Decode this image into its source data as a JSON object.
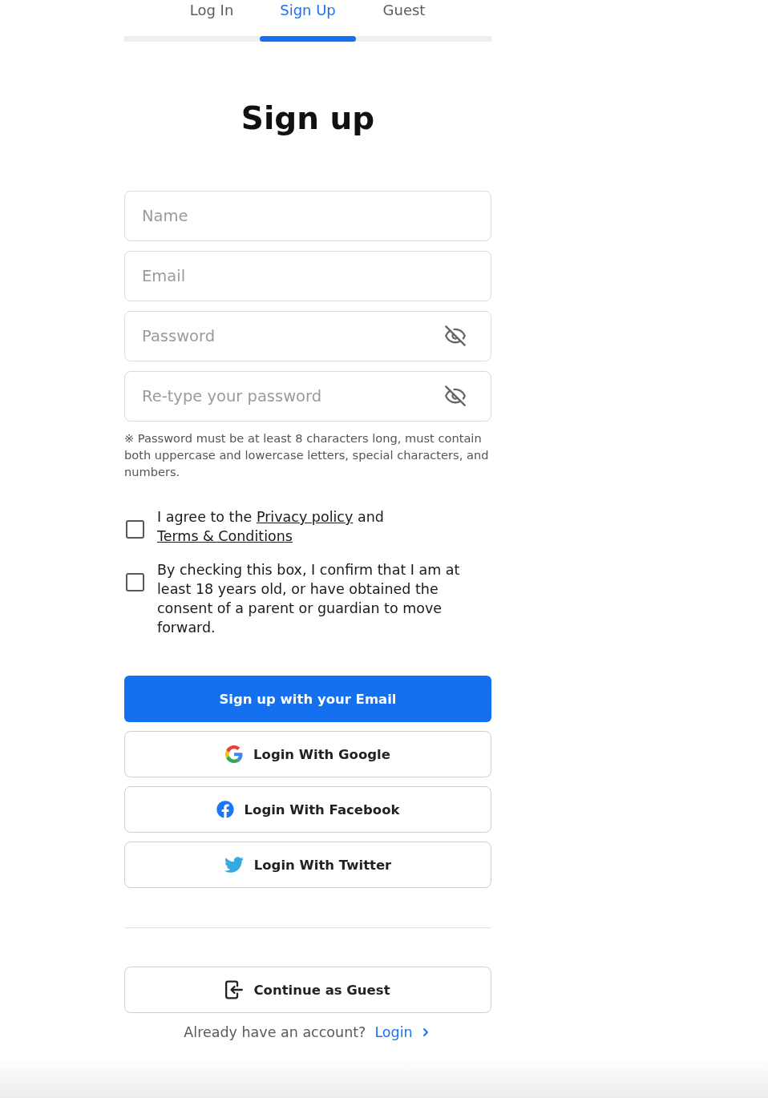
{
  "tabs": [
    {
      "label": "Log In",
      "selected": false
    },
    {
      "label": "Sign Up",
      "selected": true
    },
    {
      "label": "Guest",
      "selected": false
    }
  ],
  "title": "Sign up",
  "fields": [
    {
      "kind": "text",
      "placeholder": "Name"
    },
    {
      "kind": "text",
      "placeholder": "Email"
    },
    {
      "kind": "password",
      "placeholder": "Password",
      "revealed": false
    },
    {
      "kind": "password",
      "placeholder": "Re-type your password",
      "revealed": false
    }
  ],
  "password_hint": "※ Password must be at least 8 characters long, must contain both uppercase and lowercase letters, special characters, and numbers.",
  "agreements": [
    {
      "checked": false,
      "parts": [
        {
          "kind": "text",
          "text": "I agree to the "
        },
        {
          "kind": "link",
          "text": "Privacy policy"
        },
        {
          "kind": "text",
          "text": " and "
        },
        {
          "kind": "link",
          "text": "Terms & Conditions"
        }
      ]
    },
    {
      "checked": false,
      "parts": [
        {
          "kind": "text",
          "text": "By checking this box, I confirm that I am at least 18 years old, or have obtained the consent of a parent or guardian to move forward."
        }
      ]
    }
  ],
  "primary_button": {
    "label": "Sign up with your Email"
  },
  "social_buttons": [
    {
      "kind": "google",
      "label": "Login With Google"
    },
    {
      "kind": "facebook",
      "label": "Login With Facebook"
    },
    {
      "kind": "twitter",
      "label": "Login With Twitter"
    }
  ],
  "guest_button": {
    "label": "Continue as Guest"
  },
  "login_prompt": {
    "text": "Already have an account?",
    "link": "Login"
  }
}
